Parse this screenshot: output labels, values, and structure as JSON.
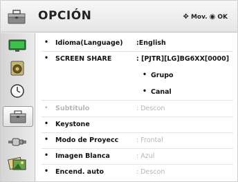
{
  "header": {
    "title": "OPCIÓN",
    "move_hint": "Mov.",
    "ok_hint": "OK",
    "icon": "toolbox-icon"
  },
  "sidebar": {
    "items": [
      {
        "name": "picture-icon"
      },
      {
        "name": "audio-icon"
      },
      {
        "name": "time-icon"
      },
      {
        "name": "option-icon",
        "active": true
      },
      {
        "name": "input-icon"
      },
      {
        "name": "media-icon"
      }
    ]
  },
  "menu": {
    "items": [
      {
        "label": "Idioma(Language)",
        "value": ":English",
        "state": "enabled"
      },
      {
        "label": "SCREEN SHARE",
        "value": ": [PJTR][LG]BG6XX[0000]",
        "state": "enabled"
      },
      {
        "label": "Grupo",
        "value": "",
        "state": "sub"
      },
      {
        "label": "Canal",
        "value": "",
        "state": "sub"
      },
      {
        "label": "Subtítulo",
        "value": ": Descon",
        "state": "disabled"
      },
      {
        "label": "Keystone",
        "value": "",
        "state": "enabled"
      },
      {
        "label": "Modo de Proyecc",
        "value": ": Frontal",
        "state": "enabled"
      },
      {
        "label": "Imagen Blanca",
        "value": ": Azul",
        "state": "enabled"
      },
      {
        "label": "Encend. auto",
        "value": ": Descon",
        "state": "enabled"
      }
    ],
    "bullet": "•"
  }
}
